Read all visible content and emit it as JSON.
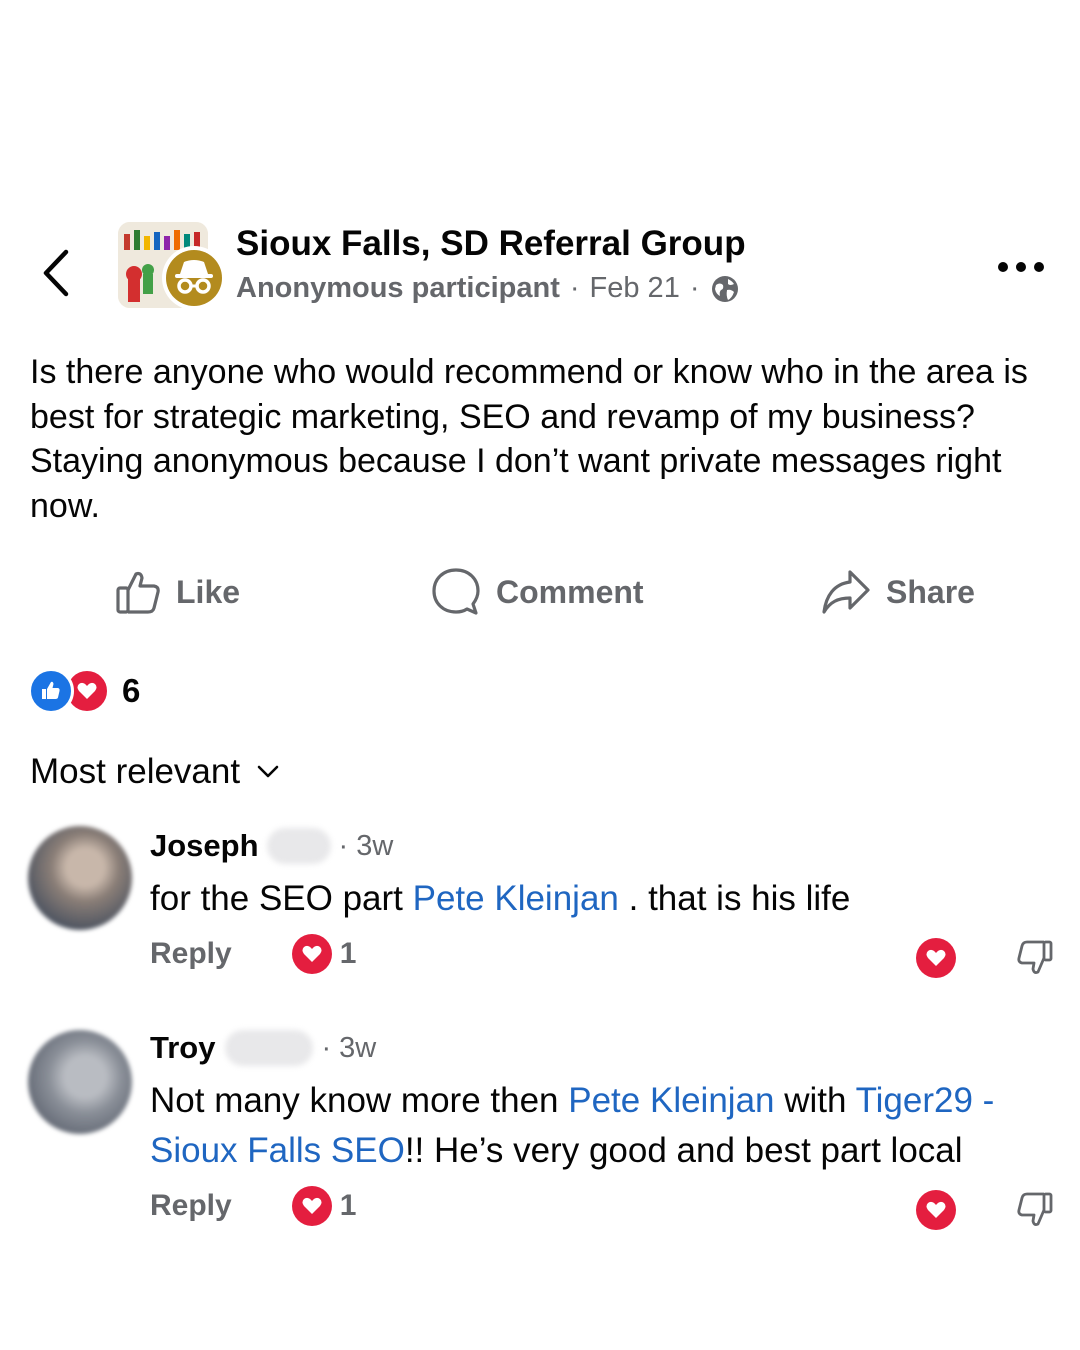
{
  "header": {
    "group_name": "Sioux Falls, SD Referral Group",
    "author": "Anonymous participant",
    "separator": "·",
    "date": "Feb 21"
  },
  "post": {
    "text": "Is there anyone who would recommend or know who in the area is best for strategic marketing, SEO and revamp of my business? Staying anonymous because I don’t want private messages right now."
  },
  "actions": {
    "like_label": "Like",
    "comment_label": "Comment",
    "share_label": "Share"
  },
  "reactions": {
    "count": "6"
  },
  "comments_sort": {
    "label": "Most relevant"
  },
  "comments": [
    {
      "name": "Joseph",
      "time": "· 3w",
      "text_before": "for the SEO part ",
      "tag1": "Pete Kleinjan",
      "text_after": " . that is his life",
      "reply_label": "Reply",
      "love_count": "1"
    },
    {
      "name": "Troy",
      "name_fragment": " ",
      "time": "· 3w",
      "text_before": "Not many know more then ",
      "tag1": "Pete Kleinjan",
      "text_mid": " with ",
      "tag2": "Tiger29 - Sioux Falls SEO",
      "text_after": "!! He’s very good and best part local",
      "reply_label": "Reply",
      "love_count": "1"
    }
  ],
  "colors": {
    "link": "#1f66c1",
    "secondary_text": "#65676b",
    "like_blue": "#1b74e4",
    "love_red": "#e41e3f",
    "anon_badge": "#b38b1e"
  },
  "icons": {
    "back": "chevron-left-icon",
    "privacy": "globe-icon",
    "more": "more-dots-icon",
    "like": "thumbs-up-icon",
    "comment": "comment-bubble-icon",
    "share": "share-arrow-icon",
    "sort": "chevron-down-icon",
    "dislike": "thumbs-down-icon"
  }
}
